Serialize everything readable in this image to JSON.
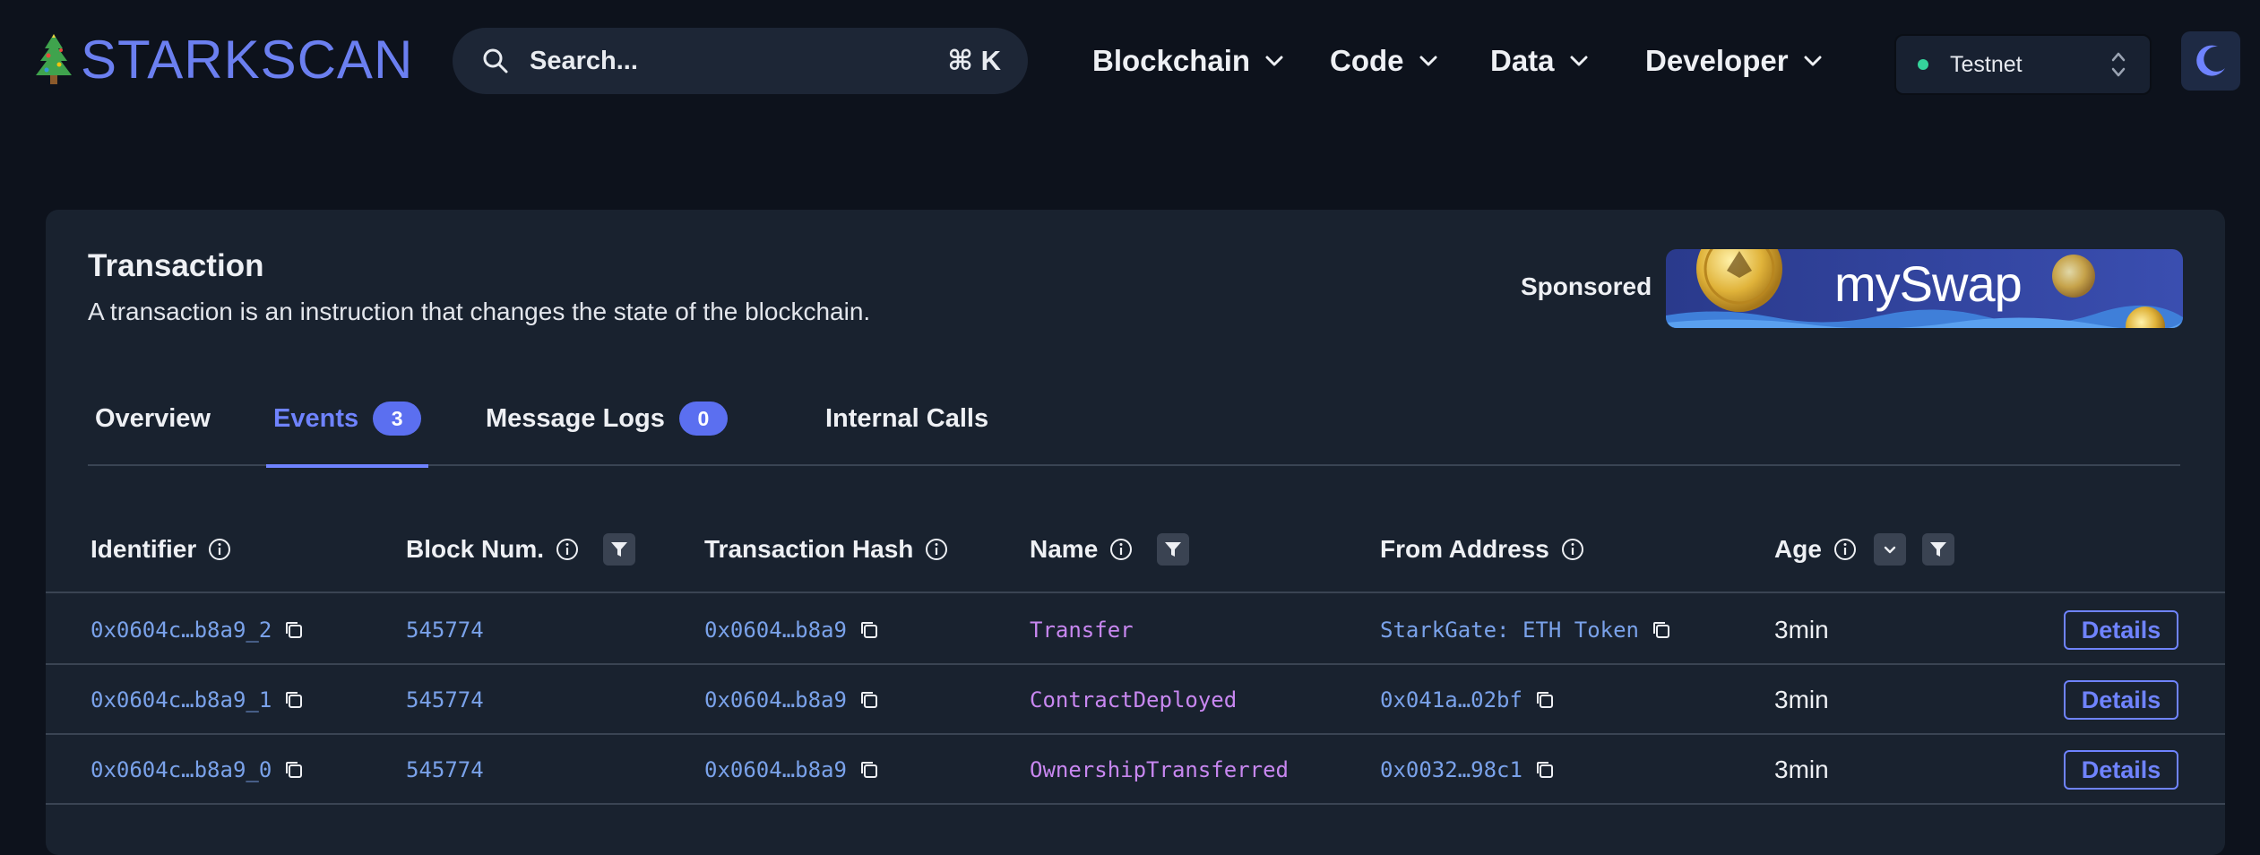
{
  "header": {
    "logo_text": "STARKSCAN",
    "logo_icon": "tree-icon",
    "search": {
      "placeholder": "Search...",
      "shortcut": "⌘ K"
    },
    "nav": [
      "Blockchain",
      "Code",
      "Data",
      "Developer"
    ],
    "network": {
      "label": "Testnet",
      "status_color": "#35d39b"
    },
    "theme_icon": "moon-icon"
  },
  "page": {
    "title": "Transaction",
    "description": "A transaction is an instruction that changes the state of the blockchain.",
    "sponsored_label": "Sponsored",
    "banner_text": "mySwap"
  },
  "tabs": [
    {
      "label": "Overview",
      "badge": null,
      "active": false
    },
    {
      "label": "Events",
      "badge": "3",
      "active": true
    },
    {
      "label": "Message Logs",
      "badge": "0",
      "active": false
    },
    {
      "label": "Internal Calls",
      "badge": null,
      "active": false
    }
  ],
  "table": {
    "headers": {
      "identifier": "Identifier",
      "block": "Block Num.",
      "tx_hash": "Transaction Hash",
      "name": "Name",
      "from": "From Address",
      "age": "Age"
    },
    "rows": [
      {
        "identifier": "0x0604c…b8a9_2",
        "block": "545774",
        "tx_hash": "0x0604…b8a9",
        "name": "Transfer",
        "from": "StarkGate: ETH Token",
        "age": "3min",
        "action": "Details"
      },
      {
        "identifier": "0x0604c…b8a9_1",
        "block": "545774",
        "tx_hash": "0x0604…b8a9",
        "name": "ContractDeployed",
        "from": "0x041a…02bf",
        "age": "3min",
        "action": "Details"
      },
      {
        "identifier": "0x0604c…b8a9_0",
        "block": "545774",
        "tx_hash": "0x0604…b8a9",
        "name": "OwnershipTransferred",
        "from": "0x0032…98c1",
        "age": "3min",
        "action": "Details"
      }
    ]
  },
  "colors": {
    "accent": "#6f83ff",
    "link": "#7aa2ea",
    "event_name": "#c887f0",
    "background": "#0d121c",
    "card": "#19222f"
  }
}
